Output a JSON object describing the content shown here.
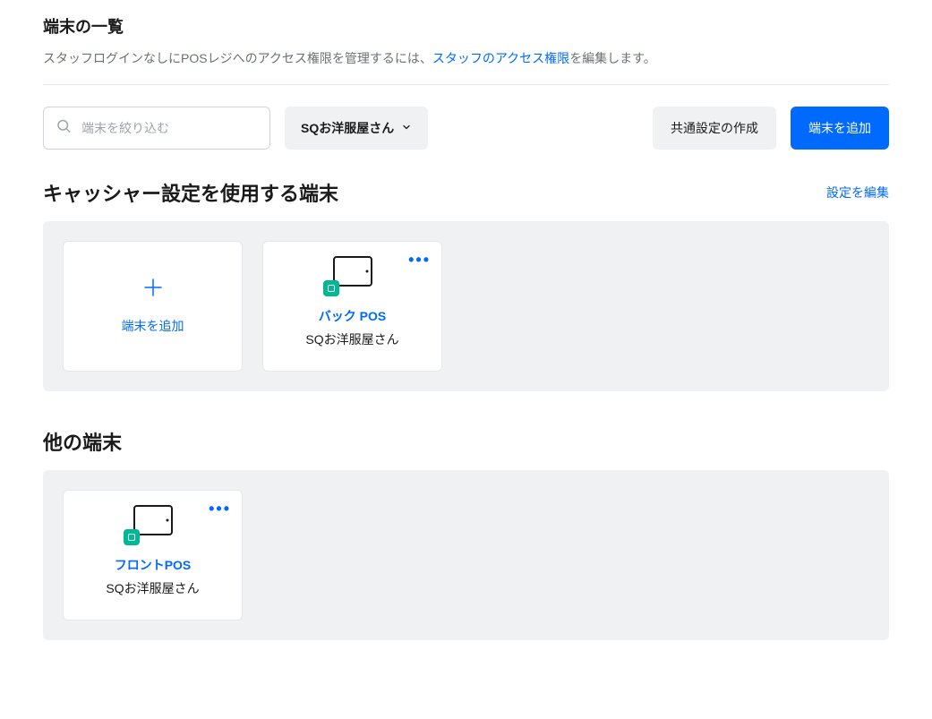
{
  "header": {
    "title": "端末の一覧",
    "subtitle_prefix": "スタッフログインなしにPOSレジへのアクセス権限を管理するには、",
    "subtitle_link": "スタッフのアクセス権限",
    "subtitle_suffix": "を編集します。"
  },
  "toolbar": {
    "search_placeholder": "端末を絞り込む",
    "location_selected": "SQお洋服屋さん",
    "create_shared_settings_label": "共通設定の作成",
    "add_device_label": "端末を追加"
  },
  "sections": [
    {
      "title": "キャッシャー設定を使用する端末",
      "edit_link": "設定を編集",
      "add_card_label": "端末を追加",
      "devices": [
        {
          "name": "バック POS",
          "location": "SQお洋服屋さん"
        }
      ]
    },
    {
      "title": "他の端末",
      "devices": [
        {
          "name": "フロントPOS",
          "location": "SQお洋服屋さん"
        }
      ]
    }
  ]
}
